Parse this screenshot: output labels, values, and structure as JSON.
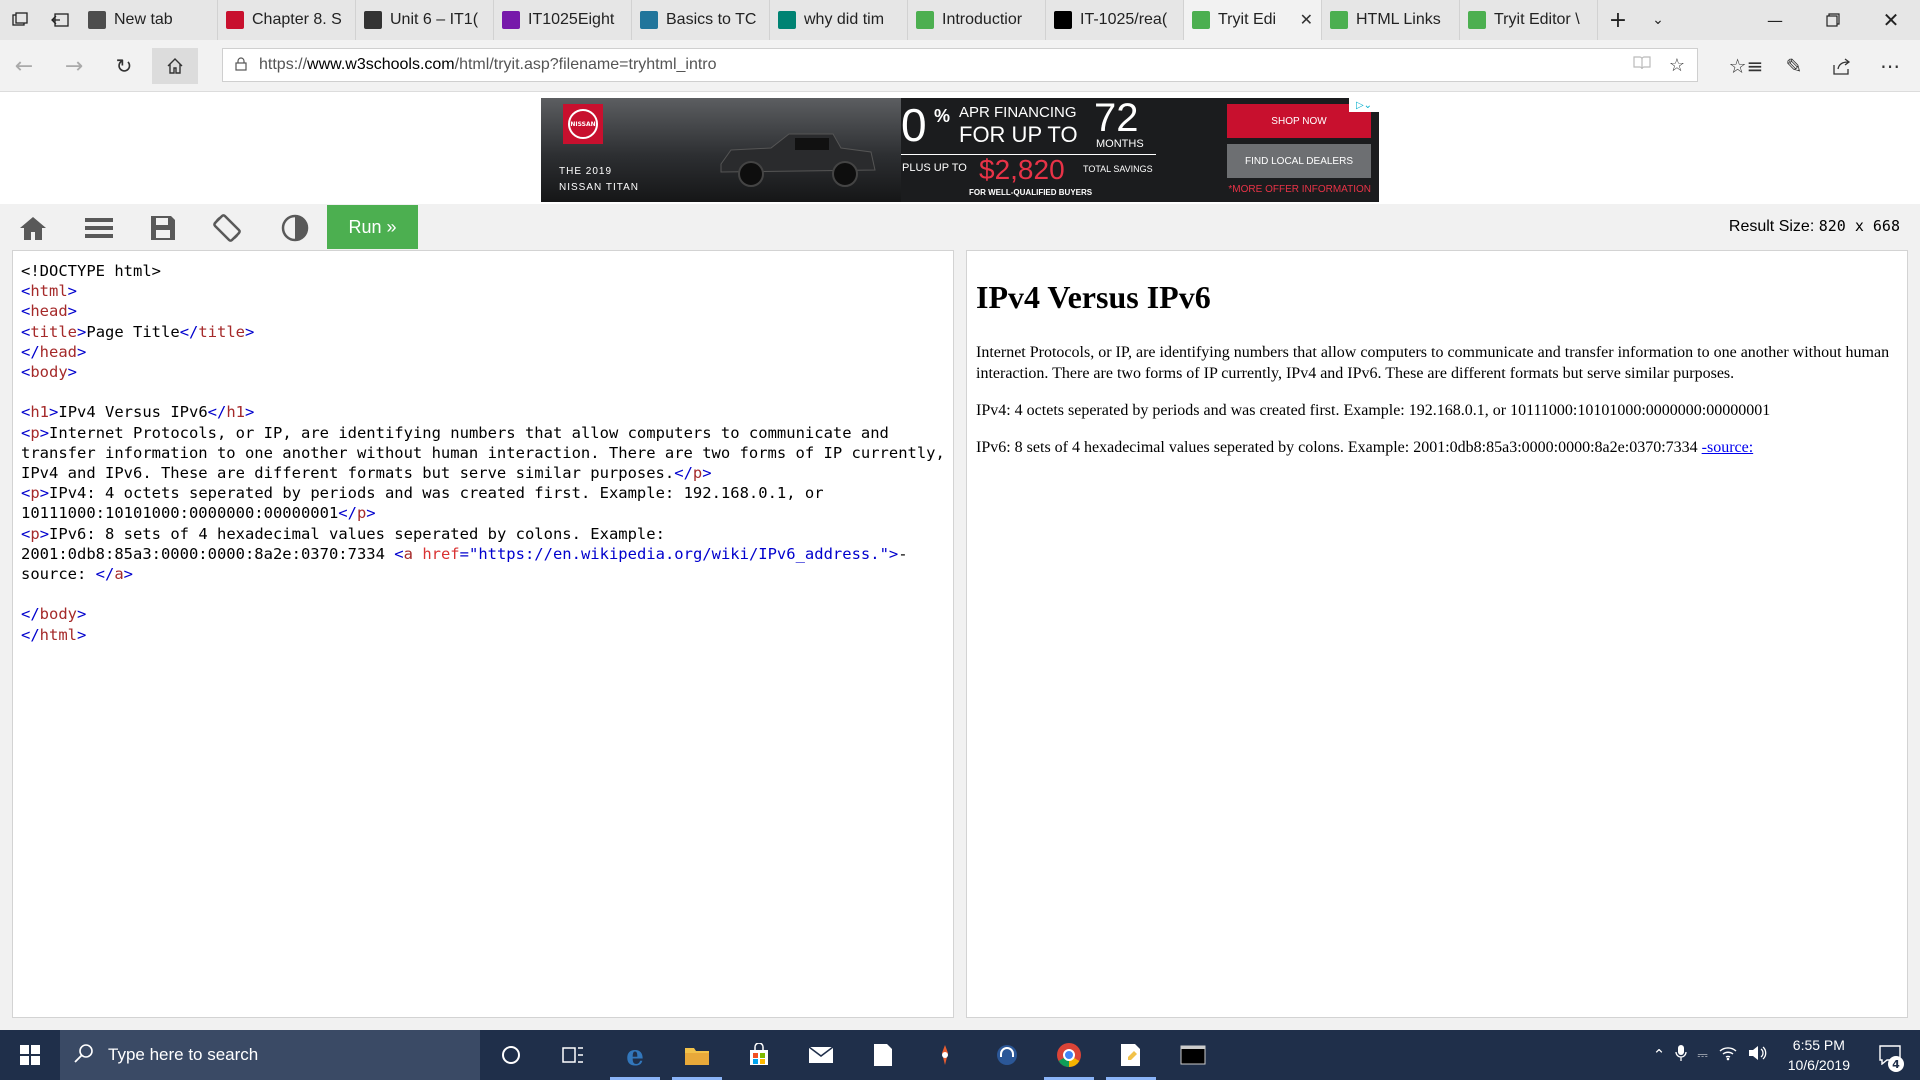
{
  "browser": {
    "tabs": [
      {
        "label": "New tab",
        "icon": "newtab-icon",
        "color": "#4d4d4d"
      },
      {
        "label": "Chapter 8. S",
        "icon": "book-icon",
        "color": "#c8102e"
      },
      {
        "label": "Unit 6 – IT1(",
        "icon": "blackboard-icon",
        "color": "#333333"
      },
      {
        "label": "IT1025Eight",
        "icon": "onenote-icon",
        "color": "#7719aa"
      },
      {
        "label": "Basics to TC",
        "icon": "wordpress-icon",
        "color": "#21759b"
      },
      {
        "label": "why did tim",
        "icon": "bing-icon",
        "color": "#008373"
      },
      {
        "label": "Introductior",
        "icon": "w3schools-icon",
        "color": "#4caf50"
      },
      {
        "label": "IT-1025/rea(",
        "icon": "github-icon",
        "color": "#000000"
      },
      {
        "label": "Tryit Edi",
        "icon": "w3schools-icon",
        "color": "#4caf50",
        "active": true
      },
      {
        "label": "HTML Links",
        "icon": "w3schools-icon",
        "color": "#4caf50"
      },
      {
        "label": "Tryit Editor \\",
        "icon": "w3schools-icon",
        "color": "#4caf50"
      }
    ],
    "url_prefix": "https://",
    "url_host": "www.w3schools.com",
    "url_path": "/html/tryit.asp?filename=tryhtml_intro"
  },
  "ad": {
    "year_line": "THE 2019",
    "model_line": "NISSAN TITAN",
    "zero": "0",
    "pct": "%",
    "apr": "APR FINANCING",
    "for_up_to": "FOR UP TO",
    "months_num": "72",
    "months": "MONTHS",
    "plus_up_to": "PLUS UP TO",
    "amount": "$2,820",
    "total_savings": "TOTAL SAVINGS",
    "well_qualified": "FOR WELL-QUALIFIED BUYERS",
    "shop_now": "SHOP NOW",
    "find_dealers": "FIND LOCAL DEALERS",
    "more_offer": "*MORE OFFER INFORMATION",
    "brand": "NISSAN"
  },
  "toolbar": {
    "run_label": "Run »",
    "result_size_label": "Result Size:",
    "result_size_value": "820 x 668"
  },
  "code": {
    "doctype": "<!DOCTYPE html>",
    "title_text": "Page Title",
    "h1_text": "IPv4 Versus IPv6",
    "p1_text": "Internet Protocols, or IP, are identifying numbers that allow computers to communicate and transfer information to one another without human interaction. There are two forms of IP currently, IPv4 and IPv6. These are different formats but serve similar purposes.",
    "p2_text": "IPv4: 4 octets seperated by periods and was created first. Example: 192.168.0.1, or 10111000:10101000:0000000:00000001",
    "p3_text": "IPv6: 8 sets of 4 hexadecimal values seperated by colons. Example: 2001:0db8:85a3:0000:0000:8a2e:0370:7334 ",
    "href_value": "\"https://en.wikipedia.org/wiki/IPv6_address.\"",
    "link_text": "-source: "
  },
  "result": {
    "heading": "IPv4 Versus IPv6",
    "p1": "Internet Protocols, or IP, are identifying numbers that allow computers to communicate and transfer information to one another without human interaction. There are two forms of IP currently, IPv4 and IPv6. These are different formats but serve similar purposes.",
    "p2": "IPv4: 4 octets seperated by periods and was created first. Example: 192.168.0.1, or 10111000:10101000:0000000:00000001",
    "p3_text": "IPv6: 8 sets of 4 hexadecimal values seperated by colons. Example: 2001:0db8:85a3:0000:0000:8a2e:0370:7334 ",
    "link_text": "-source:"
  },
  "taskbar": {
    "search_placeholder": "Type here to search",
    "time": "6:55 PM",
    "date": "10/6/2019",
    "notification_count": "4"
  }
}
